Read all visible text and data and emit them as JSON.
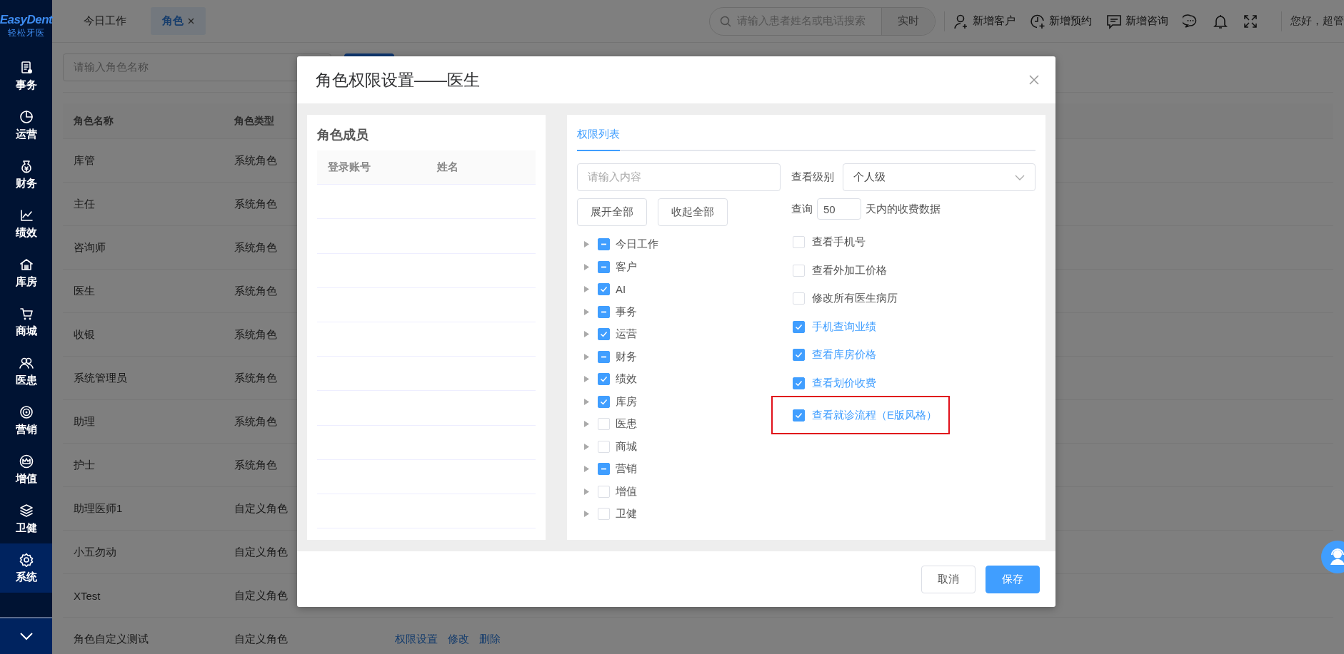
{
  "sidebar": {
    "logo": {
      "title": "EasyDent",
      "subtitle": "轻松牙医"
    },
    "items": [
      {
        "label": "事务",
        "selected": false
      },
      {
        "label": "运营",
        "selected": false
      },
      {
        "label": "财务",
        "selected": false
      },
      {
        "label": "绩效",
        "selected": false
      },
      {
        "label": "库房",
        "selected": false
      },
      {
        "label": "商城",
        "selected": false
      },
      {
        "label": "医患",
        "selected": false
      },
      {
        "label": "营销",
        "selected": false
      },
      {
        "label": "增值",
        "selected": false
      },
      {
        "label": "卫健",
        "selected": false
      },
      {
        "label": "系统",
        "selected": true
      }
    ]
  },
  "top_bar": {
    "tabs": [
      {
        "label": "今日工作",
        "selected": false
      },
      {
        "label": "角色",
        "selected": true
      }
    ],
    "search": {
      "placeholder": "请输入患者姓名或电话搜索",
      "button": "实时"
    },
    "actions": [
      "新增客户",
      "新增预约",
      "新增咨询"
    ],
    "greeting": "您好，超管"
  },
  "filter": {
    "placeholder": "请输入角色名称"
  },
  "table": {
    "columns": [
      "角色名称",
      "角色类型"
    ],
    "rows": [
      {
        "name": "库管",
        "type": "系统角色"
      },
      {
        "name": "主任",
        "type": "系统角色"
      },
      {
        "name": "咨询师",
        "type": "系统角色"
      },
      {
        "name": "医生",
        "type": "系统角色"
      },
      {
        "name": "收银",
        "type": "系统角色"
      },
      {
        "name": "系统管理员",
        "type": "系统角色"
      },
      {
        "name": "助理",
        "type": "系统角色"
      },
      {
        "name": "护士",
        "type": "系统角色"
      },
      {
        "name": "助理医师1",
        "type": "自定义角色"
      },
      {
        "name": "小五勿动",
        "type": "自定义角色"
      },
      {
        "name": "XTest",
        "type": "自定义角色"
      },
      {
        "name": "角色自定义测试",
        "type": "自定义角色",
        "actions": [
          "权限设置",
          "修改",
          "删除"
        ]
      }
    ]
  },
  "dialog": {
    "title": "角色权限设置——医生",
    "members": {
      "title": "角色成员",
      "columns": [
        "登录账号",
        "姓名"
      ]
    },
    "permissions": {
      "tab": {
        "label": "权限列表",
        "selected": true
      },
      "search": {
        "placeholder": "请输入内容"
      },
      "buttons": [
        "展开全部",
        "收起全部"
      ],
      "tree": [
        {
          "label": "今日工作",
          "checked": true,
          "indeterminate": true
        },
        {
          "label": "客户",
          "checked": true,
          "indeterminate": true
        },
        {
          "label": "AI",
          "checked": true,
          "indeterminate": false
        },
        {
          "label": "事务",
          "checked": true,
          "indeterminate": true
        },
        {
          "label": "运营",
          "checked": true,
          "indeterminate": false
        },
        {
          "label": "财务",
          "checked": true,
          "indeterminate": true
        },
        {
          "label": "绩效",
          "checked": true,
          "indeterminate": false
        },
        {
          "label": "库房",
          "checked": true,
          "indeterminate": false
        },
        {
          "label": "医患",
          "checked": false,
          "indeterminate": false
        },
        {
          "label": "商城",
          "checked": false,
          "indeterminate": false
        },
        {
          "label": "营销",
          "checked": true,
          "indeterminate": true
        },
        {
          "label": "增值",
          "checked": false,
          "indeterminate": false
        },
        {
          "label": "卫健",
          "checked": false,
          "indeterminate": false
        }
      ],
      "view_level": {
        "label": "查看级别",
        "value": "个人级"
      },
      "query": {
        "prefix": "查询",
        "value": "50",
        "suffix": "天内的收费数据"
      },
      "options": [
        {
          "label": "查看手机号",
          "checked": false,
          "highlighted": false
        },
        {
          "label": "查看外加工价格",
          "checked": false,
          "highlighted": false
        },
        {
          "label": "修改所有医生病历",
          "checked": false,
          "highlighted": false
        },
        {
          "label": "手机查询业绩",
          "checked": true,
          "highlighted": false
        },
        {
          "label": "查看库房价格",
          "checked": true,
          "highlighted": false
        },
        {
          "label": "查看划价收费",
          "checked": true,
          "highlighted": false
        },
        {
          "label": "查看就诊流程（E版风格）",
          "checked": true,
          "highlighted": true
        }
      ]
    },
    "footer_buttons": [
      {
        "label": "取消",
        "kind": "default"
      },
      {
        "label": "保存",
        "kind": "primary"
      }
    ]
  }
}
